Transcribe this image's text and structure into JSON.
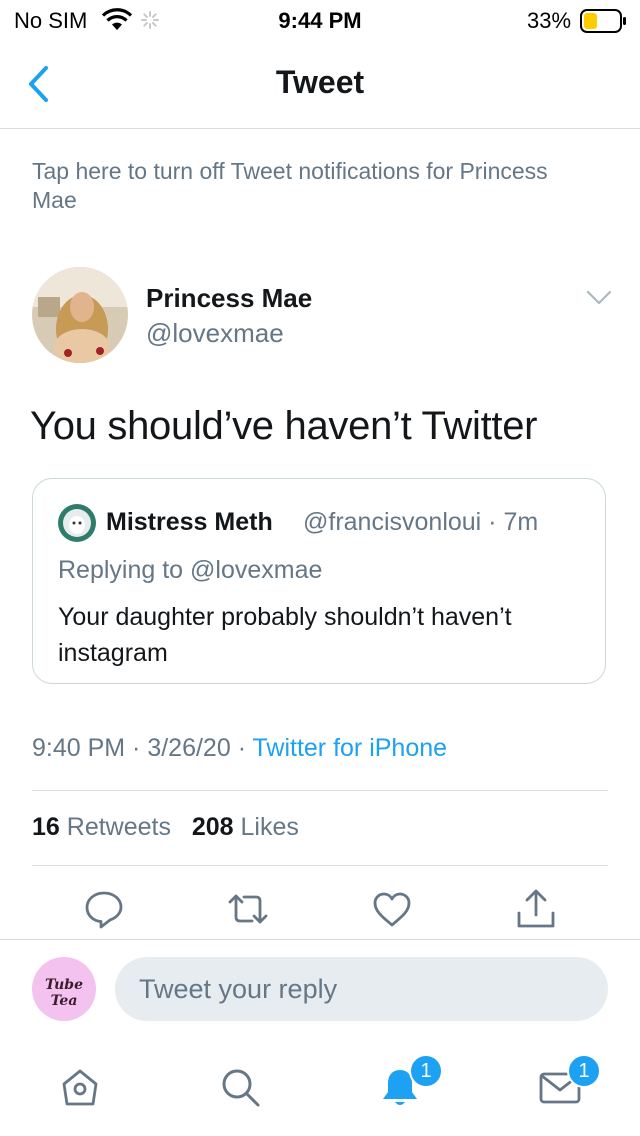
{
  "status_bar": {
    "carrier": "No SIM",
    "time": "9:44 PM",
    "battery": "33%"
  },
  "nav": {
    "title": "Tweet",
    "back_icon": "chevron-left-icon"
  },
  "notification_text": "Tap here to turn off Tweet notifications for Princess Mae",
  "tweet": {
    "author_name": "Princess Mae",
    "author_handle": "@lovexmae",
    "text": "You should’ve haven’t Twitter",
    "quoted": {
      "author_name": "Mistress Meth",
      "meta": "@francisvonloui · 7m",
      "replying_to": "Replying to @lovexmae",
      "text": "Your daughter probably shouldn’t haven’t instagram"
    },
    "time": "9:40 PM",
    "date": "3/26/20",
    "separator": " · ",
    "source": "Twitter for iPhone",
    "retweets_count": "16",
    "retweets_label": " Retweets",
    "likes_count": "208",
    "likes_label": " Likes"
  },
  "actions": [
    "reply-icon",
    "retweet-icon",
    "like-icon",
    "share-icon"
  ],
  "reply_bar": {
    "avatar_text": "Tube Tea",
    "placeholder": "Tweet your reply"
  },
  "tab_bar": {
    "items": [
      "home-icon",
      "search-icon",
      "notifications-icon",
      "messages-icon"
    ],
    "notifications_badge": "1",
    "messages_badge": "1"
  },
  "colors": {
    "accent": "#1da1f2",
    "secondary_text": "#657786",
    "divider": "#dadde0"
  }
}
